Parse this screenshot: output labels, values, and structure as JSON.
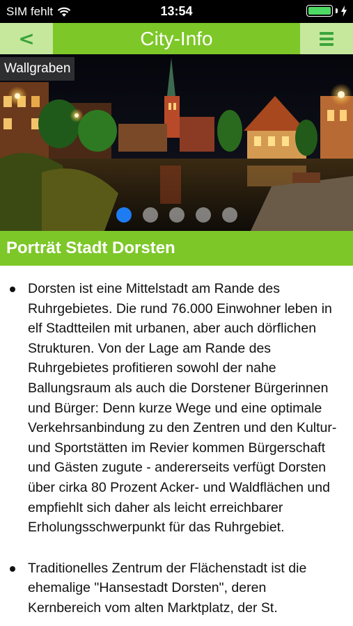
{
  "status_bar": {
    "carrier": "SIM fehlt",
    "time": "13:54",
    "battery_level": 1.0,
    "battery_color": "#4cd964"
  },
  "nav": {
    "title": "City-Info",
    "back_label": "<",
    "menu_icon": "hamburger-menu-icon",
    "bar_color": "#7dc728",
    "button_color": "#c6e89d"
  },
  "hero": {
    "caption": "Wallgraben",
    "slide_count": 5,
    "active_slide": 1
  },
  "section": {
    "title": "Porträt Stadt Dorsten"
  },
  "content": {
    "paragraphs": [
      "Dorsten ist eine Mittelstadt am Rande des Ruhrgebietes. Die rund 76.000 Einwohner leben in elf Stadtteilen mit urbanen, aber auch dörflichen Strukturen. Von der Lage am Rande des Ruhrgebietes profitieren sowohl der nahe Ballungsraum als auch die Dorstener Bürgerinnen und Bürger: Denn kurze Wege und eine optimale Verkehrsanbindung zu den Zentren und den Kultur- und Sportstätten im Revier kommen Bürgerschaft und Gästen zugute - andererseits verfügt Dorsten über cirka 80 Prozent Acker- und Waldflächen und empfiehlt sich daher als leicht erreichbarer Erholungsschwerpunkt für das Ruhrgebiet.",
      "Traditionelles Zentrum der Flächenstadt ist die ehemalige \"Hansestadt Dorsten\", deren Kernbereich vom alten Marktplatz, der St."
    ]
  }
}
